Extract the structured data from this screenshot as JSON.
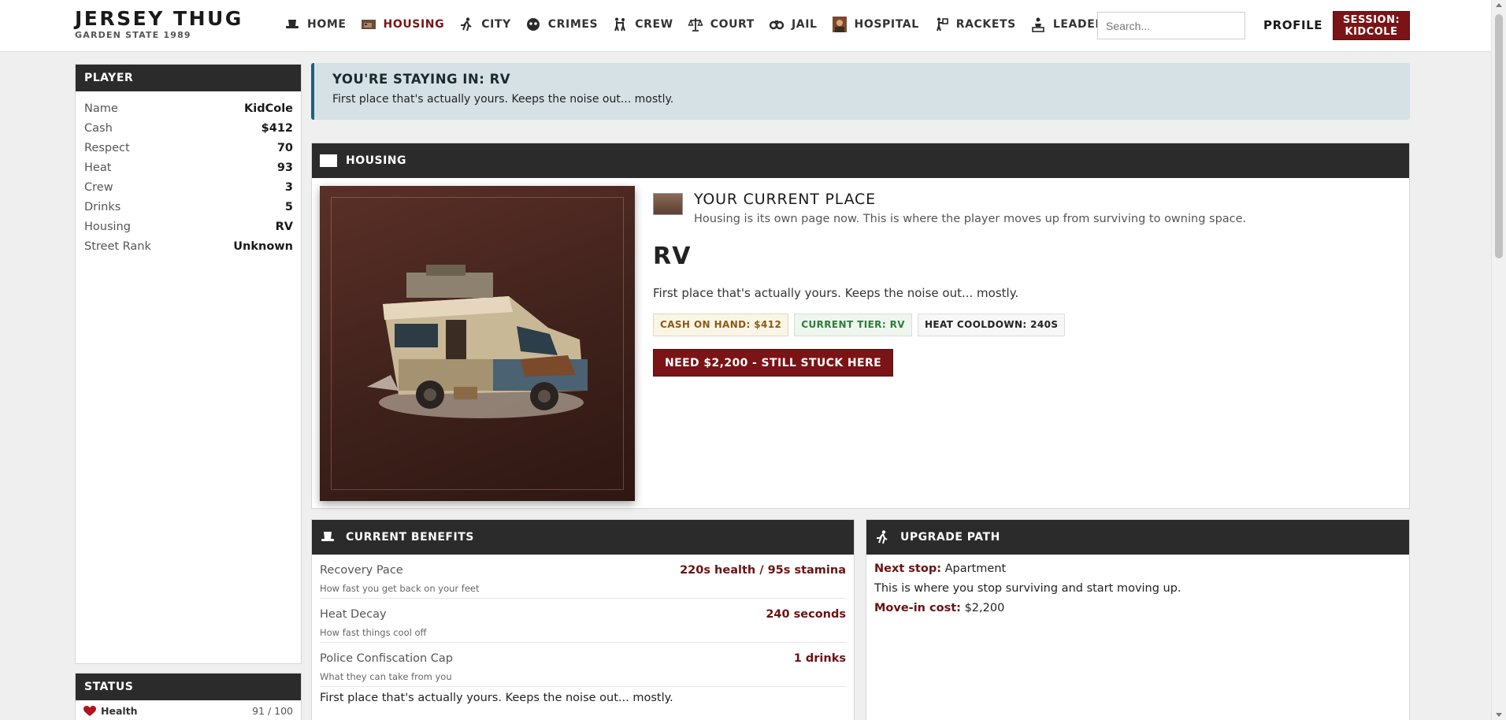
{
  "brand": {
    "title": "JERSEY THUG",
    "subtitle": "GARDEN STATE 1989"
  },
  "nav": {
    "items": [
      {
        "label": "HOME",
        "icon": "hat-icon"
      },
      {
        "label": "HOUSING",
        "icon": "house-photo-icon",
        "active": true
      },
      {
        "label": "CITY",
        "icon": "runner-icon"
      },
      {
        "label": "CRIMES",
        "icon": "mask-icon"
      },
      {
        "label": "CREW",
        "icon": "crew-icon"
      },
      {
        "label": "COURT",
        "icon": "scales-icon"
      },
      {
        "label": "JAIL",
        "icon": "handcuffs-icon"
      },
      {
        "label": "HOSPITAL",
        "icon": "doctor-portrait-icon"
      },
      {
        "label": "RACKETS",
        "icon": "racket-icon"
      },
      {
        "label": "LEADERBOARD",
        "icon": "leaderboard-icon"
      }
    ],
    "search_placeholder": "Search...",
    "profile_label": "PROFILE",
    "session_line1": "SESSION:",
    "session_line2": "KIDCOLE"
  },
  "player": {
    "title": "PLAYER",
    "rows": [
      {
        "k": "Name",
        "v": "KidCole"
      },
      {
        "k": "Cash",
        "v": "$412"
      },
      {
        "k": "Respect",
        "v": "70"
      },
      {
        "k": "Heat",
        "v": "93"
      },
      {
        "k": "Crew",
        "v": "3"
      },
      {
        "k": "Drinks",
        "v": "5"
      },
      {
        "k": "Housing",
        "v": "RV"
      },
      {
        "k": "Street Rank",
        "v": "Unknown"
      }
    ]
  },
  "status": {
    "title": "STATUS",
    "health_label": "Health",
    "health_value": "91 / 100"
  },
  "banner": {
    "title": "YOU'RE STAYING IN: RV",
    "text": "First place that's actually yours. Keeps the noise out... mostly."
  },
  "housing": {
    "header": "HOUSING",
    "current_title": "YOUR CURRENT PLACE",
    "current_desc": "Housing is its own page now. This is where the player moves up from surviving to owning space.",
    "place_name": "RV",
    "place_line": "First place that's actually yours. Keeps the noise out... mostly.",
    "badges": {
      "cash": "CASH ON HAND: $412",
      "tier": "CURRENT TIER: RV",
      "heat": "HEAT COOLDOWN: 240S"
    },
    "need_button": "NEED $2,200 - STILL STUCK HERE"
  },
  "benefits": {
    "header": "CURRENT BENEFITS",
    "rows": [
      {
        "k": "Recovery Pace",
        "sub": "How fast you get back on your feet",
        "v": "220s health / 95s stamina"
      },
      {
        "k": "Heat Decay",
        "sub": "How fast things cool off",
        "v": "240 seconds"
      },
      {
        "k": "Police Confiscation Cap",
        "sub": "What they can take from you",
        "v": "1 drinks"
      }
    ],
    "footer": "First place that's actually yours. Keeps the noise out... mostly."
  },
  "upgrade": {
    "header": "UPGRADE PATH",
    "next_label": "Next stop:",
    "next_value": "Apartment",
    "line": "This is where you stop surviving and start moving up.",
    "cost_label": "Move-in cost:",
    "cost_value": "$2,200"
  }
}
